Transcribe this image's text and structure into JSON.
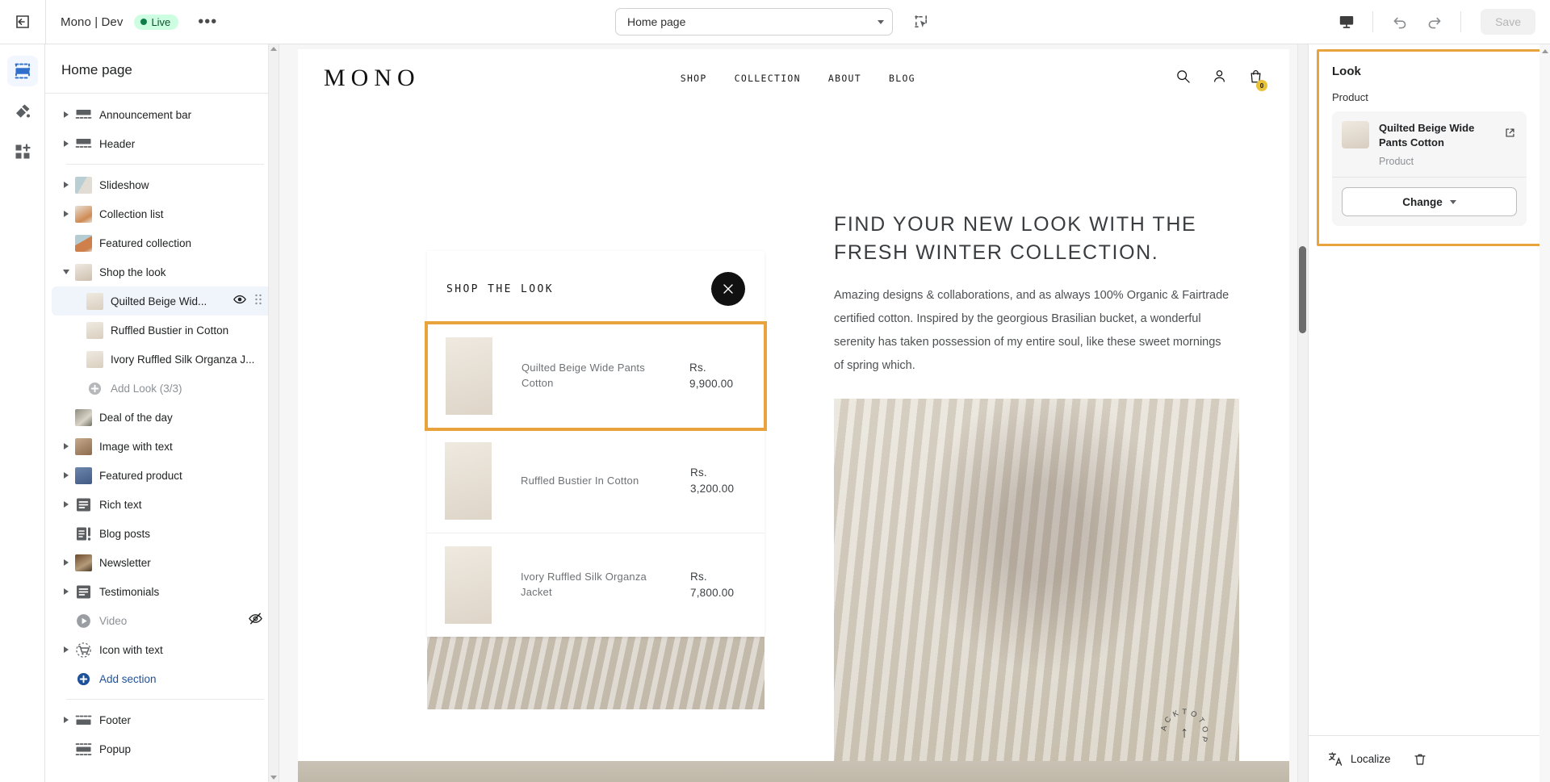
{
  "topbar": {
    "exit_icon": "exit-icon",
    "store_name": "Mono | Dev",
    "live_label": "Live",
    "more_label": "•••",
    "page_selector_value": "Home page",
    "select_tool_icon": "select-cursor-icon",
    "device_icon": "desktop-icon",
    "undo_icon": "undo-icon",
    "redo_icon": "redo-icon",
    "save_label": "Save"
  },
  "rail": {
    "items": [
      {
        "name": "sections-icon",
        "label": "Sections"
      },
      {
        "name": "theme-settings-icon",
        "label": "Theme settings"
      },
      {
        "name": "apps-icon",
        "label": "Apps"
      }
    ]
  },
  "sidebar": {
    "title": "Home page",
    "items": [
      {
        "label": "Announcement bar",
        "icon": "announcement-bar-icon",
        "expandable": true,
        "indent": 0
      },
      {
        "label": "Header",
        "icon": "header-icon",
        "expandable": true,
        "indent": 0
      },
      {
        "separator": true
      },
      {
        "label": "Slideshow",
        "icon": "slideshow-thumb",
        "expandable": true,
        "indent": 0
      },
      {
        "label": "Collection list",
        "icon": "collection-list-thumb",
        "expandable": true,
        "indent": 0
      },
      {
        "label": "Featured collection",
        "icon": "featured-collection-thumb",
        "expandable": false,
        "indent": 0
      },
      {
        "label": "Shop the look",
        "icon": "shop-the-look-thumb",
        "expandable": true,
        "expanded": true,
        "indent": 0
      },
      {
        "label": "Quilted Beige Wid...",
        "icon": "product-thumb",
        "indent": 1,
        "selected": true,
        "eye": true,
        "drag": true
      },
      {
        "label": "Ruffled Bustier in Cotton",
        "icon": "product-thumb",
        "indent": 1
      },
      {
        "label": "Ivory Ruffled Silk Organza J...",
        "icon": "product-thumb",
        "indent": 1
      },
      {
        "label": "Add Look (3/3)",
        "icon": "plus-circle-icon",
        "indent": 1,
        "muted": true
      },
      {
        "label": "Deal of the day",
        "icon": "deal-thumb",
        "expandable": false,
        "indent": 0
      },
      {
        "label": "Image with text",
        "icon": "image-with-text-thumb",
        "expandable": true,
        "indent": 0
      },
      {
        "label": "Featured product",
        "icon": "featured-product-thumb",
        "expandable": true,
        "indent": 0
      },
      {
        "label": "Rich text",
        "icon": "rich-text-icon",
        "expandable": true,
        "indent": 0
      },
      {
        "label": "Blog posts",
        "icon": "blog-posts-icon",
        "expandable": false,
        "indent": 0
      },
      {
        "label": "Newsletter",
        "icon": "newsletter-thumb",
        "expandable": true,
        "indent": 0
      },
      {
        "label": "Testimonials",
        "icon": "testimonials-icon",
        "expandable": true,
        "indent": 0
      },
      {
        "label": "Video",
        "icon": "video-icon",
        "expandable": false,
        "indent": 0,
        "muted": true,
        "hidden_eye": true
      },
      {
        "label": "Icon with text",
        "icon": "cart-outline-icon",
        "expandable": true,
        "indent": 0
      },
      {
        "label": "Add section",
        "icon": "add-section-icon",
        "indent": 0,
        "link": true
      },
      {
        "separator": true
      },
      {
        "label": "Footer",
        "icon": "footer-icon",
        "expandable": true,
        "indent": 0
      },
      {
        "label": "Popup",
        "icon": "popup-icon",
        "expandable": false,
        "indent": 0
      }
    ]
  },
  "preview": {
    "logo": "MONO",
    "nav": [
      "SHOP",
      "COLLECTION",
      "ABOUT",
      "BLOG"
    ],
    "search_icon": "search-icon",
    "account_icon": "account-icon",
    "cart_icon": "cart-icon",
    "cart_count": "0",
    "shop_the_look": {
      "title": "SHOP THE LOOK",
      "close_icon": "close-icon",
      "items": [
        {
          "name": "Quilted Beige Wide Pants Cotton",
          "price": "Rs. 9,900.00",
          "selected": true
        },
        {
          "name": "Ruffled Bustier In Cotton",
          "price": "Rs. 3,200.00",
          "selected": false
        },
        {
          "name": "Ivory Ruffled Silk Organza Jacket",
          "price": "Rs. 7,800.00",
          "selected": false
        }
      ]
    },
    "heading": "FIND YOUR NEW LOOK WITH THE FRESH WINTER COLLECTION.",
    "paragraph": "Amazing designs & collaborations, and as always 100% Organic & Fairtrade certified cotton. Inspired by the georgious Brasilian bucket, a wonderful serenity has taken possession of my entire soul, like these sweet mornings of spring which.",
    "back_to_top": "BACK TO TOP"
  },
  "right_panel": {
    "title": "Look",
    "product_label": "Product",
    "product_name": "Quilted Beige Wide Pants Cotton",
    "product_type": "Product",
    "external_link_icon": "external-link-icon",
    "change_label": "Change",
    "localize_label": "Localize",
    "localize_icon": "translate-icon",
    "delete_icon": "trash-icon"
  },
  "colors": {
    "accent_highlight": "#e8a33d",
    "link": "#1f5199",
    "live_badge_bg": "#cdfee1",
    "live_badge_text": "#0c5132"
  }
}
